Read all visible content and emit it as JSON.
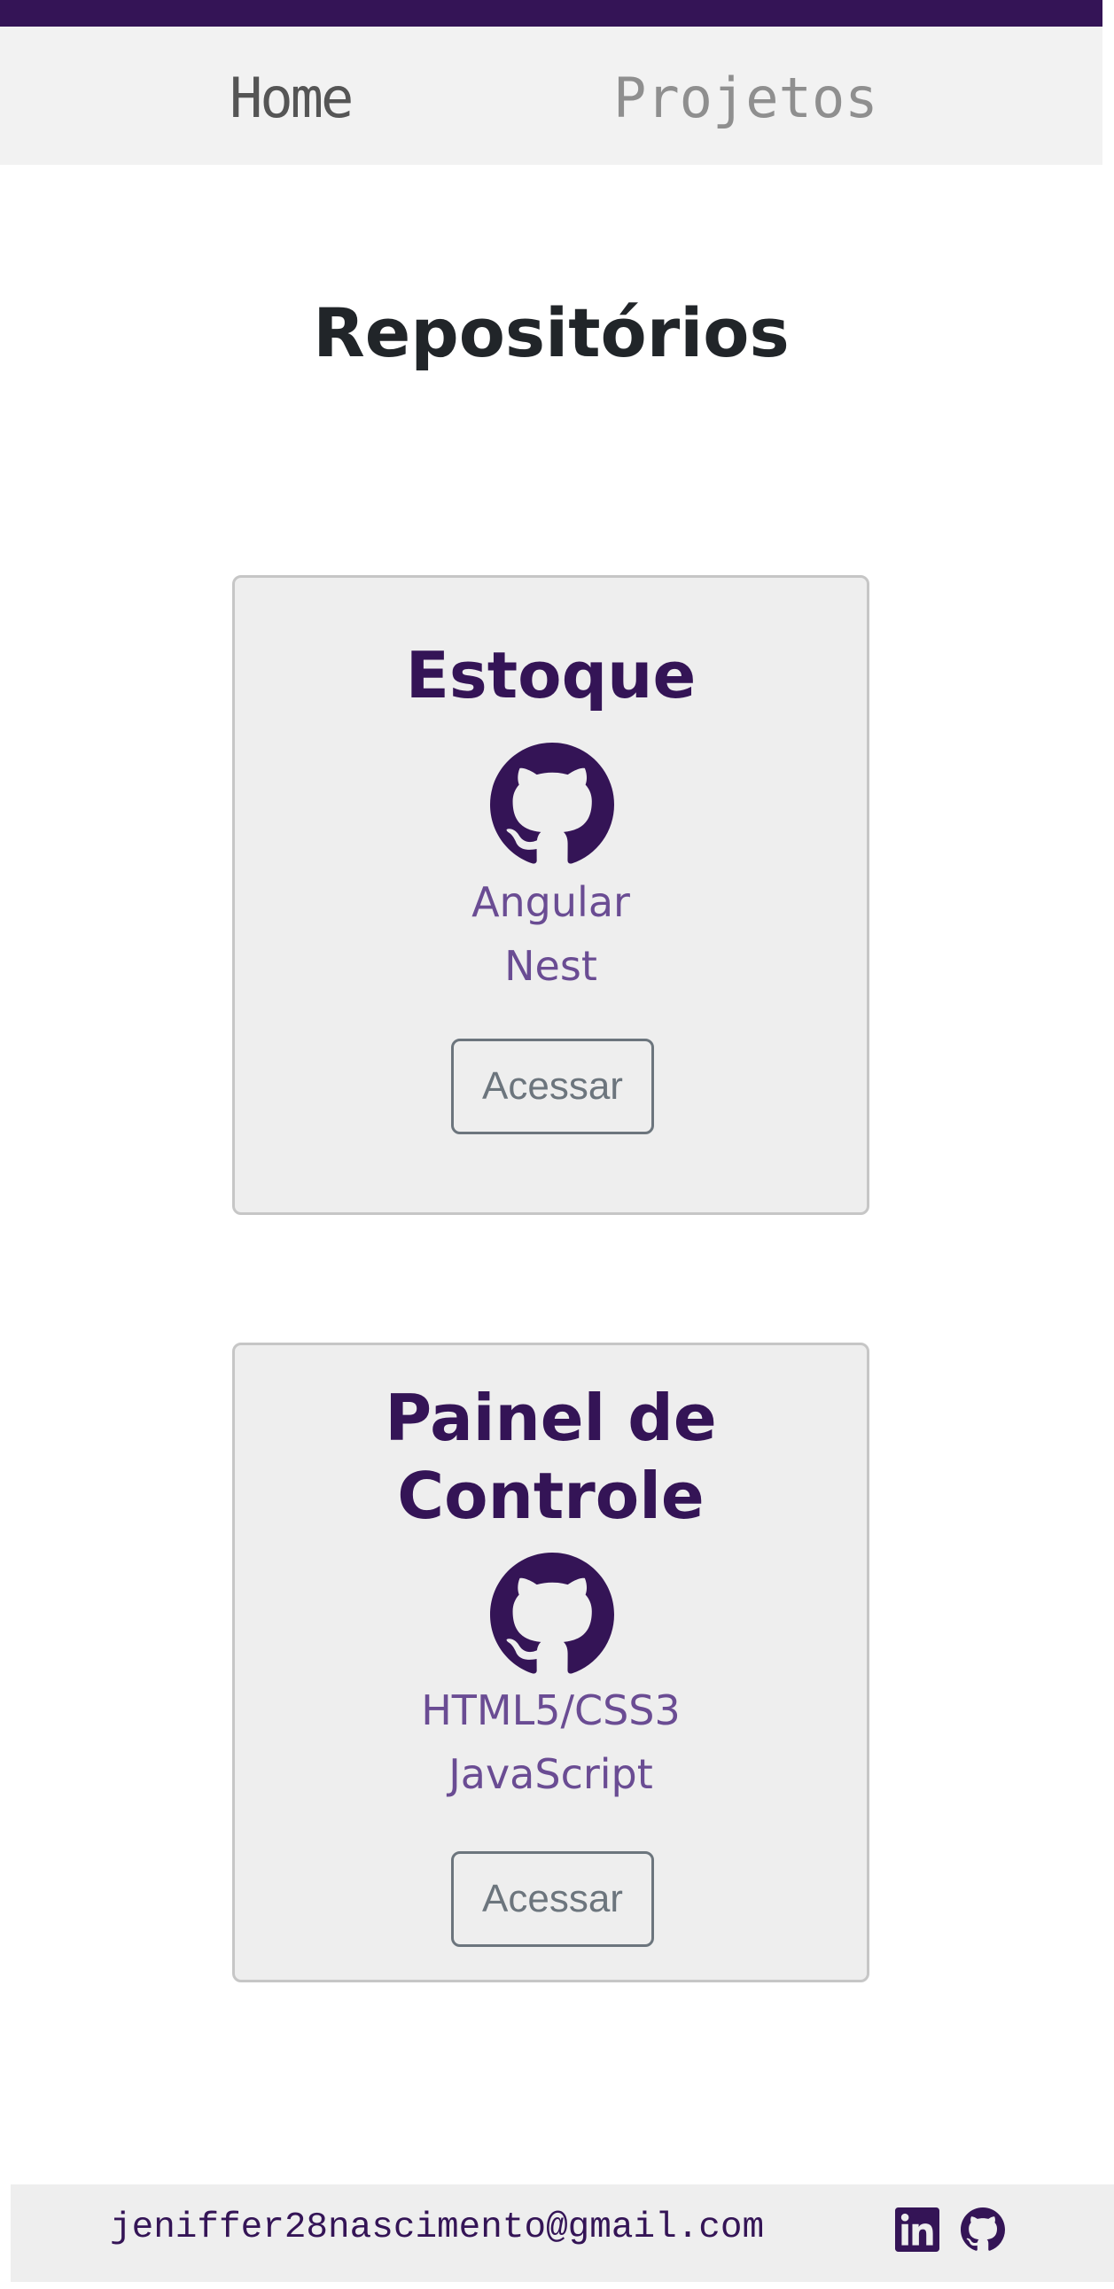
{
  "nav": {
    "items": [
      {
        "label": "Home"
      },
      {
        "label": "Projetos"
      }
    ]
  },
  "page": {
    "title": "Repositórios"
  },
  "repositories": [
    {
      "title": "Estoque",
      "icon": "github-icon",
      "technologies": [
        "Angular",
        "Nest"
      ],
      "button_label": "Acessar"
    },
    {
      "title": "Painel de Controle",
      "icon": "github-icon",
      "technologies": [
        "HTML5/CSS3",
        "JavaScript"
      ],
      "button_label": "Acessar"
    }
  ],
  "footer": {
    "email": "jeniffer28nascimento@gmail.com",
    "social_icons": [
      "linkedin-icon",
      "github-icon"
    ]
  },
  "colors": {
    "brand": "#341456",
    "tech_text": "#6a4c93",
    "nav_background": "#f2f2f2",
    "card_background": "#eeeeee",
    "button_border": "#6c757d"
  }
}
